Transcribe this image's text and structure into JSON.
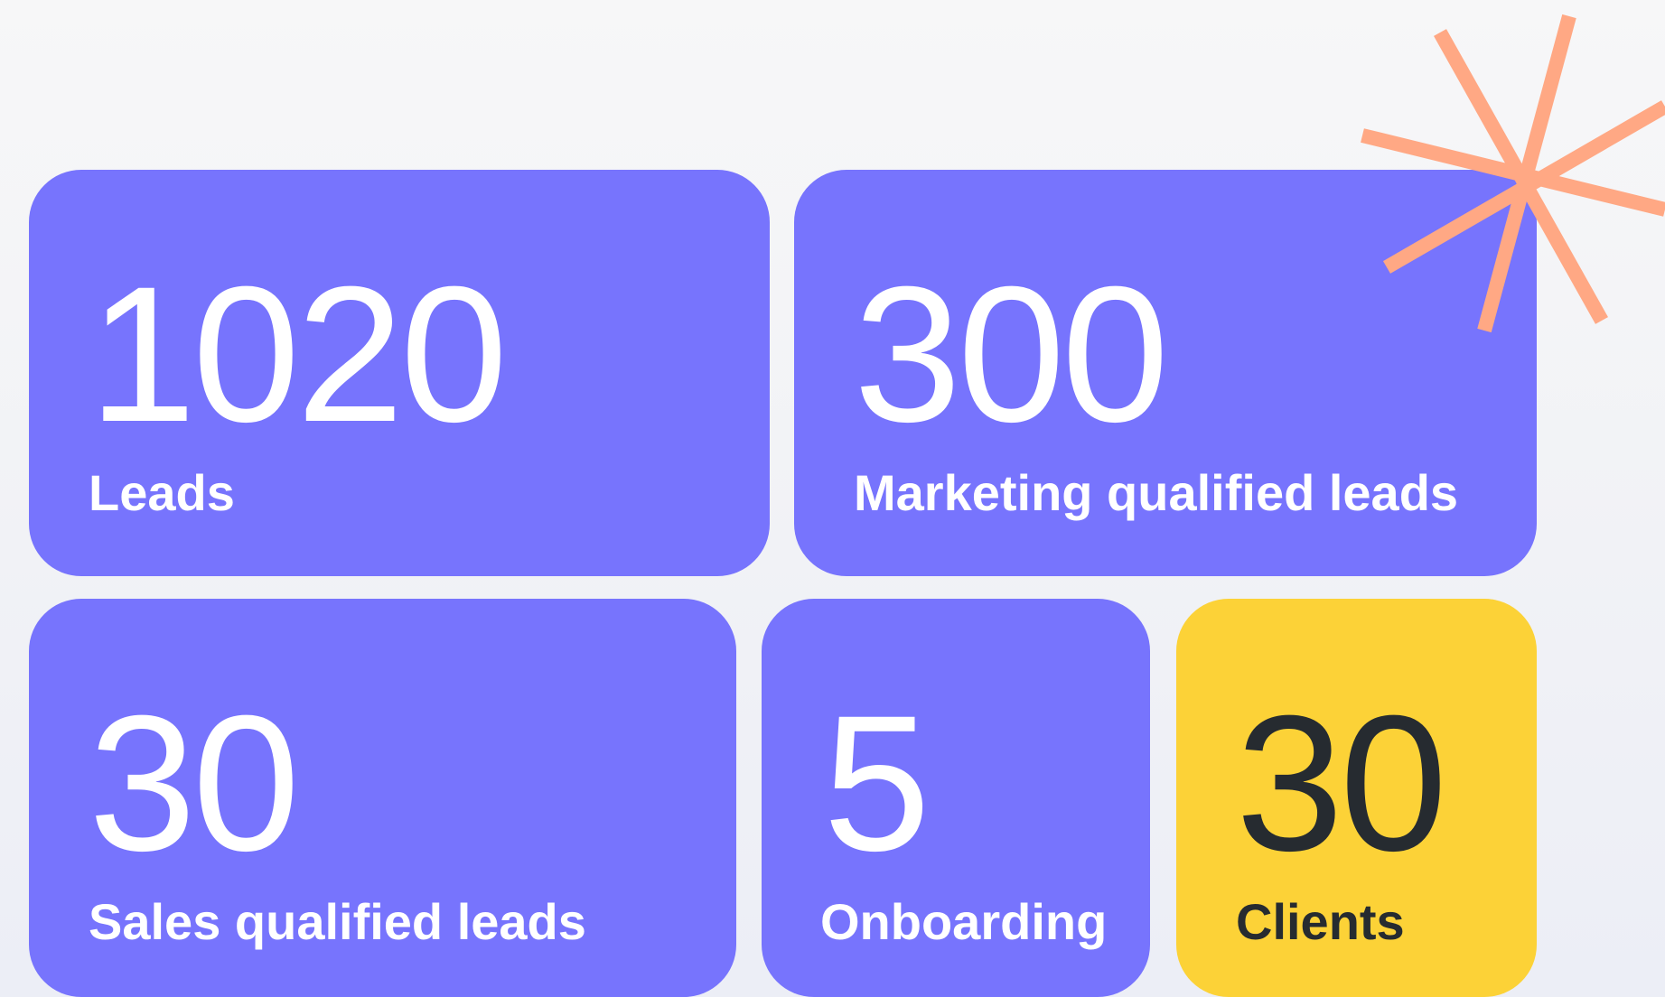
{
  "colors": {
    "card_primary": "#7774fd",
    "card_highlight": "#fcd237",
    "text_on_primary": "#ffffff",
    "text_on_highlight": "#262b30",
    "accent_sparkle": "#ffa884",
    "background": "#f3f4f7"
  },
  "decoration": {
    "icon": "sparkle-icon"
  },
  "stats": {
    "leads": {
      "value": "1020",
      "label": "Leads"
    },
    "marketing_qualified": {
      "value": "300",
      "label": "Marketing qualified leads"
    },
    "sales_qualified": {
      "value": "30",
      "label": "Sales qualified leads"
    },
    "onboarding": {
      "value": "5",
      "label": "Onboarding"
    },
    "clients": {
      "value": "30",
      "label": "Clients"
    }
  }
}
